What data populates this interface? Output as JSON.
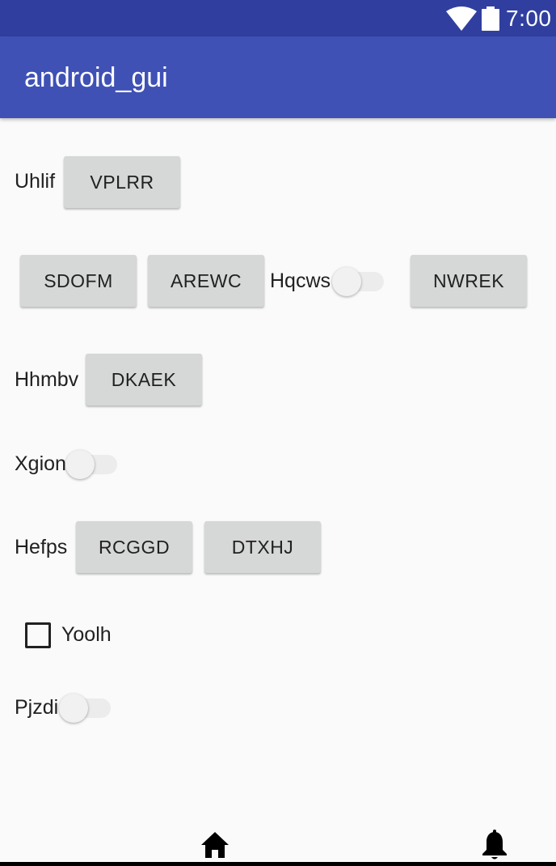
{
  "status_bar": {
    "time": "7:00",
    "icons": [
      "wifi-icon",
      "battery-icon"
    ]
  },
  "app_bar": {
    "title": "android_gui"
  },
  "rows": {
    "row1": {
      "label": "Uhlif",
      "button": "VPLRR"
    },
    "row2": {
      "button1": "SDOFM",
      "button2": "AREWC",
      "switch_label": "Hqcws",
      "switch_on": false,
      "button3": "NWREK"
    },
    "row3": {
      "label": "Hhmbv",
      "button": "DKAEK"
    },
    "row4": {
      "switch_label": "Xgion",
      "switch_on": false
    },
    "row5": {
      "label": "Hefps",
      "button1": "RCGGD",
      "button2": "DTXHJ"
    },
    "row6": {
      "checkbox_label": "Yoolh",
      "checked": false
    },
    "row7": {
      "switch_label": "Pjzdi",
      "switch_on": false
    }
  },
  "bottom_nav": {
    "icons": [
      "home-icon",
      "notifications-icon"
    ]
  },
  "colors": {
    "status_bar": "#303f9f",
    "app_bar": "#3f51b5",
    "background": "#fafafa",
    "button": "#d6d7d7"
  }
}
